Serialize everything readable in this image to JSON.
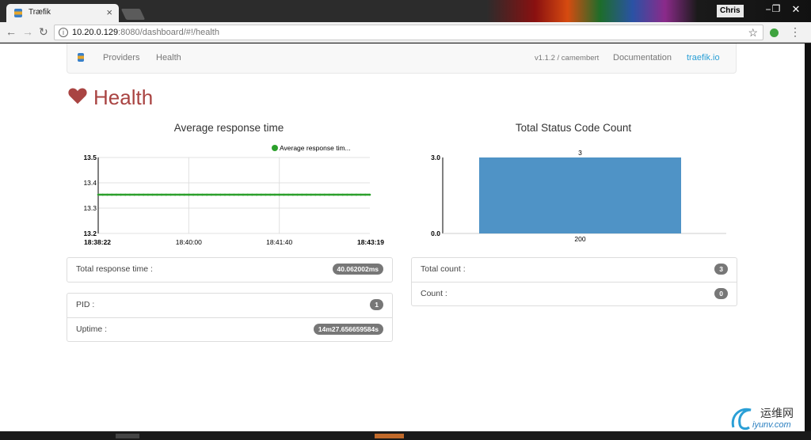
{
  "browser": {
    "tab_title": "Træfik",
    "url_host": "10.20.0.129",
    "url_path": ":8080/dashboard/#!/health",
    "user_name": "Chris",
    "icons": {
      "back": "arrow-left-icon",
      "forward": "arrow-right-icon",
      "reload": "reload-icon",
      "info": "info-icon",
      "bookmark": "star-icon",
      "extension": "extension-icon",
      "menu": "kebab-menu-icon"
    }
  },
  "navbar": {
    "providers": "Providers",
    "health": "Health",
    "version": "v1.1.2 / camembert",
    "documentation": "Documentation",
    "site": "traefik.io"
  },
  "page": {
    "title": "Health",
    "title_color": "#a94442",
    "response_chart_title": "Average response time",
    "status_chart_title": "Total Status Code Count"
  },
  "chart_data": [
    {
      "type": "line",
      "legend": "Average response tim...",
      "legend_position": "top-right",
      "y_ticks": [
        "13.5",
        "13.4",
        "13.3",
        "13.2"
      ],
      "ylim": [
        13.2,
        13.5
      ],
      "x_ticks": [
        "18:38:22",
        "18:40:00",
        "18:41:40",
        "18:43:19"
      ],
      "series": [
        {
          "name": "Average response tim...",
          "color": "#2ca02c",
          "values": [
            13.353,
            13.353,
            13.353,
            13.353
          ]
        }
      ],
      "grid": true
    },
    {
      "type": "bar",
      "categories": [
        "200"
      ],
      "values": [
        3
      ],
      "data_labels": [
        "3"
      ],
      "y_ticks": [
        "3.0",
        "0.0"
      ],
      "ylim": [
        0,
        3
      ],
      "color": "#4f93c6"
    }
  ],
  "panels": {
    "response": {
      "label": "Total response time :",
      "value": "40.062002ms"
    },
    "pid": {
      "label": "PID :",
      "value": "1"
    },
    "uptime": {
      "label": "Uptime :",
      "value": "14m27.656659584s"
    },
    "total_count": {
      "label": "Total count :",
      "value": "3"
    },
    "count": {
      "label": "Count :",
      "value": "0"
    }
  },
  "watermark": {
    "cn": "运维网",
    "url": "iyunv.com"
  }
}
